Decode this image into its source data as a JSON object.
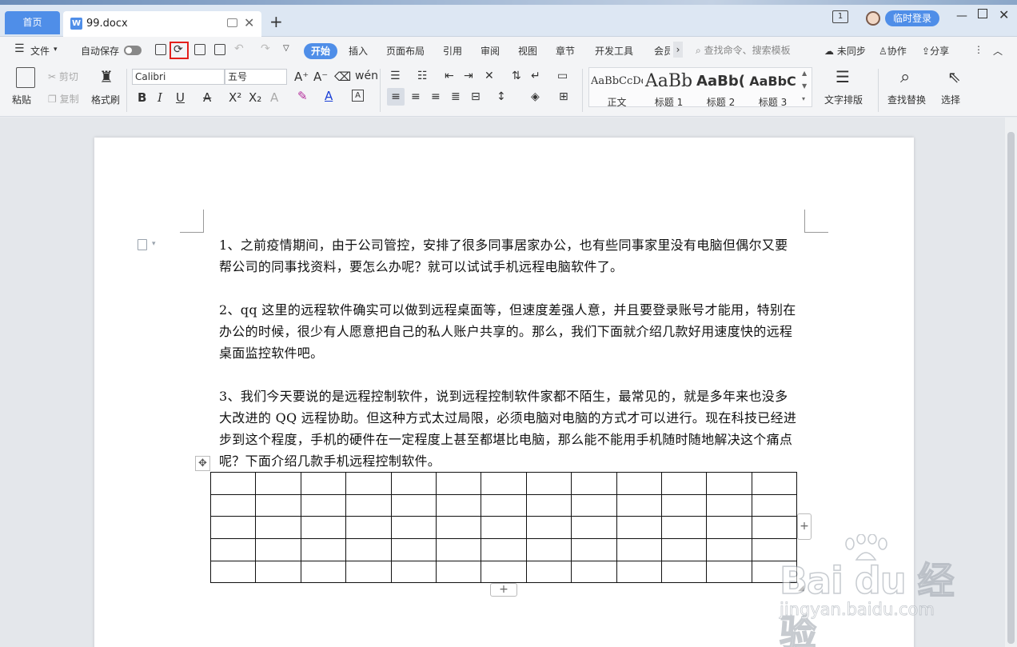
{
  "titlebar": {
    "home_tab": "首页",
    "doc_tab_title": "99.docx",
    "doc_icon_letter": "W",
    "login_label": "临时登录",
    "page_count_badge": "1"
  },
  "menu": {
    "file": "文件",
    "autosave": "自动保存",
    "tabs": [
      "开始",
      "插入",
      "页面布局",
      "引用",
      "审阅",
      "视图",
      "章节",
      "开发工具",
      "会员"
    ],
    "active_tab": "开始",
    "search_placeholder": "查找命令、搜索模板",
    "sync": "未同步",
    "collab": "协作",
    "share": "分享"
  },
  "ribbon": {
    "paste": "粘贴",
    "cut": "剪切",
    "copy": "复制",
    "format_painter": "格式刷",
    "font_name": "Calibri",
    "font_size": "五号",
    "styles": [
      {
        "preview": "AaBbCcDd",
        "label": "正文"
      },
      {
        "preview": "AaBb",
        "label": "标题 1"
      },
      {
        "preview": "AaBb(",
        "label": "标题 2"
      },
      {
        "preview": "AaBbC",
        "label": "标题 3"
      }
    ],
    "text_layout": "文字排版",
    "find_replace": "查找替换",
    "select": "选择"
  },
  "document": {
    "paragraphs": [
      "1、之前疫情期间，由于公司管控，安排了很多同事居家办公，也有些同事家里没有电脑但偶尔又要帮公司的同事找资料，要怎么办呢？就可以试试手机远程电脑软件了。",
      "2、qq 这里的远程软件确实可以做到远程桌面等，但速度差强人意，并且要登录账号才能用，特别在办公的时候，很少有人愿意把自己的私人账户共享的。那么，我们下面就介绍几款好用速度快的远程桌面监控软件吧。",
      "3、我们今天要说的是远程控制软件，说到远程控制软件家都不陌生，最常见的，就是多年来也没多大改进的 QQ 远程协助。但这种方式太过局限，必须电脑对电脑的方式才可以进行。现在科技已经进步到这个程度，手机的硬件在一定程度上甚至都堪比电脑，那么能不能用手机随时随地解决这个痛点呢？下面介绍几款手机远程控制软件。"
    ],
    "table": {
      "rows": 5,
      "cols": 13
    }
  },
  "watermark": {
    "brand": "Bai du 经验",
    "url": "jingyan.baidu.com"
  },
  "colors": {
    "accent": "#4f8ee8",
    "highlight_box": "#e3201b"
  }
}
